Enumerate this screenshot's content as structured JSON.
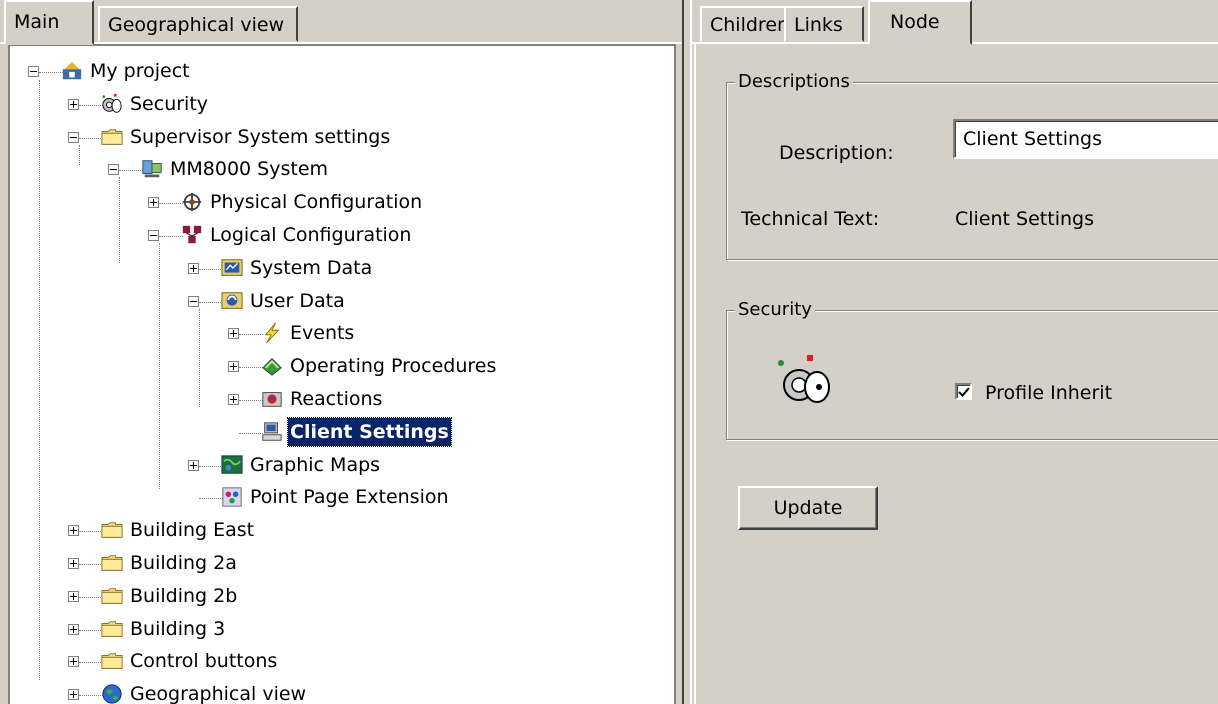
{
  "left_tabs": [
    {
      "label": "Main",
      "active": true
    },
    {
      "label": "Geographical view",
      "active": false
    }
  ],
  "tree": [
    {
      "label": "My project",
      "icon": "project-icon",
      "expander": "minus"
    },
    {
      "label": "Security",
      "icon": "security-key-icon",
      "expander": "plus"
    },
    {
      "label": "Supervisor System settings",
      "icon": "folder-icon",
      "expander": "minus"
    },
    {
      "label": "MM8000 System",
      "icon": "system-computer-icon",
      "expander": "minus"
    },
    {
      "label": "Physical Configuration",
      "icon": "physical-config-icon",
      "expander": "plus"
    },
    {
      "label": "Logical Configuration",
      "icon": "logical-config-icon",
      "expander": "minus"
    },
    {
      "label": "System Data",
      "icon": "system-data-icon",
      "expander": "plus"
    },
    {
      "label": "User Data",
      "icon": "user-data-icon",
      "expander": "minus"
    },
    {
      "label": "Events",
      "icon": "lightning-icon",
      "expander": "plus"
    },
    {
      "label": "Operating Procedures",
      "icon": "book-icon",
      "expander": "plus"
    },
    {
      "label": "Reactions",
      "icon": "reactions-icon",
      "expander": "plus"
    },
    {
      "label": "Client Settings",
      "icon": "client-computer-icon",
      "expander": "none",
      "selected": true
    },
    {
      "label": "Graphic Maps",
      "icon": "map-icon",
      "expander": "plus"
    },
    {
      "label": "Point Page Extension",
      "icon": "point-page-icon",
      "expander": "none"
    },
    {
      "label": "Building East",
      "icon": "folder-icon",
      "expander": "plus"
    },
    {
      "label": "Building 2a",
      "icon": "folder-icon",
      "expander": "plus"
    },
    {
      "label": "Building 2b",
      "icon": "folder-icon",
      "expander": "plus"
    },
    {
      "label": "Building 3",
      "icon": "folder-icon",
      "expander": "plus"
    },
    {
      "label": "Control buttons",
      "icon": "folder-icon",
      "expander": "plus"
    },
    {
      "label": "Geographical view",
      "icon": "globe-icon",
      "expander": "plus"
    }
  ],
  "right_tabs": [
    {
      "label": "Children",
      "active": false
    },
    {
      "label": "Links",
      "active": false
    },
    {
      "label": "Node",
      "active": true
    }
  ],
  "descriptions": {
    "title": "Descriptions",
    "description_label": "Description:",
    "description_value": "Client Settings",
    "technical_label": "Technical Text:",
    "technical_value": "Client Settings"
  },
  "security": {
    "title": "Security",
    "icon": "security-key-icon",
    "profile_inherit_label": "Profile Inherit",
    "profile_inherit_checked": true
  },
  "update_button": {
    "label": "Update"
  }
}
